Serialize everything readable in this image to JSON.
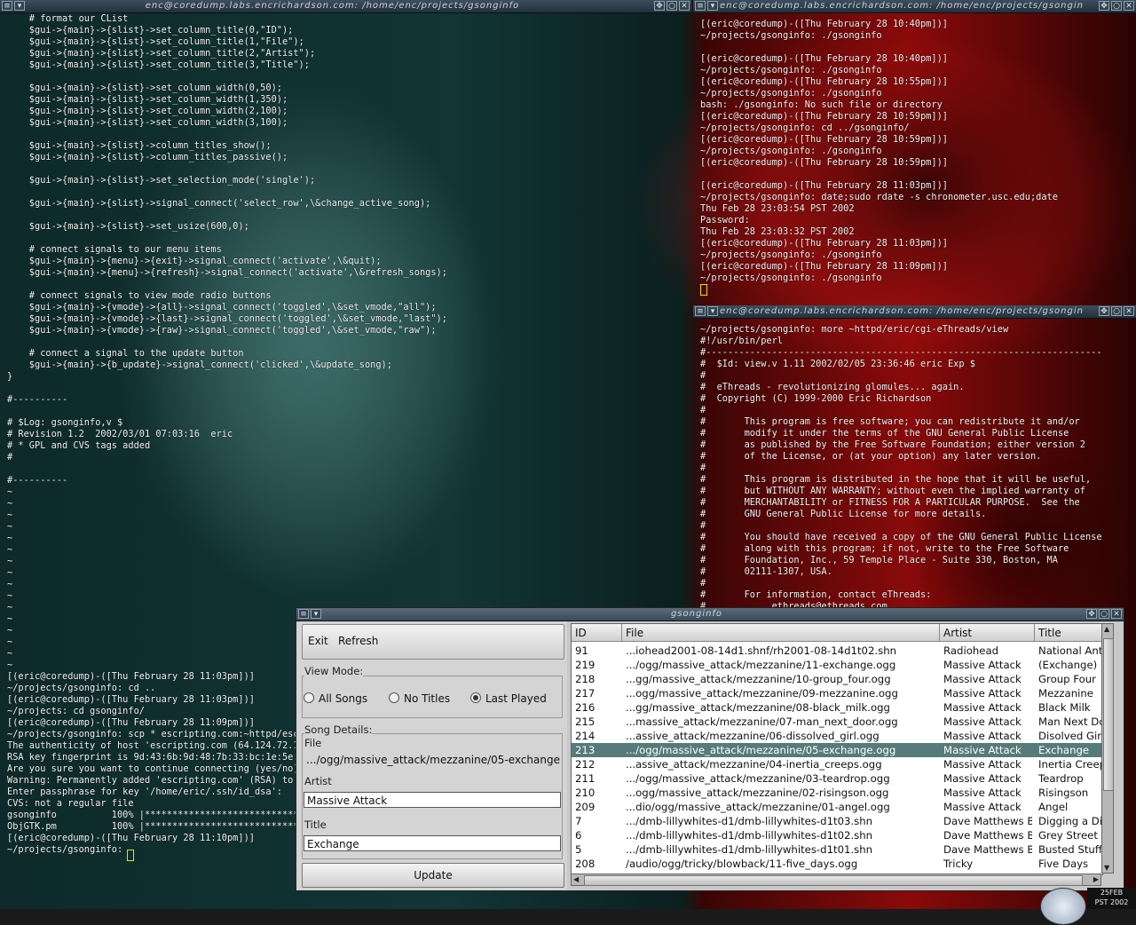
{
  "colors": {
    "cursor": "#e6e600",
    "selection": "#577a7a"
  },
  "left_terminal": {
    "title": "enc@coredump.labs.encrichardson.com: /home/enc/projects/gsonginfo",
    "content": "    # format our CList\n    $gui->{main}->{slist}->set_column_title(0,\"ID\");\n    $gui->{main}->{slist}->set_column_title(1,\"File\");\n    $gui->{main}->{slist}->set_column_title(2,\"Artist\");\n    $gui->{main}->{slist}->set_column_title(3,\"Title\");\n\n    $gui->{main}->{slist}->set_column_width(0,50);\n    $gui->{main}->{slist}->set_column_width(1,350);\n    $gui->{main}->{slist}->set_column_width(2,100);\n    $gui->{main}->{slist}->set_column_width(3,100);\n\n    $gui->{main}->{slist}->column_titles_show();\n    $gui->{main}->{slist}->column_titles_passive();\n\n    $gui->{main}->{slist}->set_selection_mode('single');\n\n    $gui->{main}->{slist}->signal_connect('select_row',\\&change_active_song);\n\n    $gui->{main}->{slist}->set_usize(600,0);\n\n    # connect signals to our menu items\n    $gui->{main}->{menu}->{exit}->signal_connect('activate',\\&quit);\n    $gui->{main}->{menu}->{refresh}->signal_connect('activate',\\&refresh_songs);\n\n    # connect signals to view mode radio buttons\n    $gui->{main}->{vmode}->{all}->signal_connect('toggled',\\&set_vmode,\"all\");\n    $gui->{main}->{vmode}->{last}->signal_connect('toggled',\\&set_vmode,\"last\");\n    $gui->{main}->{vmode}->{raw}->signal_connect('toggled',\\&set_vmode,\"raw\");\n\n    # connect a signal to the update button\n    $gui->{main}->{b_update}->signal_connect('clicked',\\&update_song);\n}\n\n#----------\n\n# $Log: gsonginfo,v $\n# Revision 1.2  2002/03/01 07:03:16  eric\n# * GPL and CVS tags added\n#\n\n#----------\n~\n~\n~\n~\n~\n~\n~\n~\n~\n~\n~\n~\n~\n~\n~\n~\n[(eric@coredump)-([Thu February 28 11:03pm])]\n~/projects/gsonginfo: cd ..\n[(eric@coredump)-([Thu February 28 11:03pm])]\n~/projects: cd gsonginfo/\n[(eric@coredump)-([Thu February 28 11:09pm])]\n~/projects/gsonginfo: scp * escripting.com:~httpd/escripting\nThe authenticity of host 'escripting.com (64.124.72.10)' can't be established.\nRSA key fingerprint is 9d:43:6b:9d:48:7b:33:bc:1e:5e:c7\nAre you sure you want to continue connecting (yes/no)? yes\nWarning: Permanently added 'escripting.com' (RSA) to the list of known hosts.\nEnter passphrase for key '/home/eric/.ssh/id_dsa':\nCVS: not a regular file\ngsonginfo          100% |*********************************\nObjGTK.pm          100% |*********************************\n[(eric@coredump)-([Thu February 28 11:10pm])]\n~/projects/gsonginfo: "
  },
  "right_top_terminal": {
    "title": "enc@coredump.labs.encrichardson.com: /home/enc/projects/gsonginfo",
    "content": "[(eric@coredump)-([Thu February 28 10:40pm])]\n~/projects/gsonginfo: ./gsonginfo\n\n[(eric@coredump)-([Thu February 28 10:40pm])]\n~/projects/gsonginfo: ./gsonginfo\n[(eric@coredump)-([Thu February 28 10:55pm])]\n~/projects/gsonginfo: ./gsonginfo\nbash: ./gsonginfo: No such file or directory\n[(eric@coredump)-([Thu February 28 10:59pm])]\n~/projects/gsonginfo: cd ../gsonginfo/\n[(eric@coredump)-([Thu February 28 10:59pm])]\n~/projects/gsonginfo: ./gsonginfo\n[(eric@coredump)-([Thu February 28 10:59pm])]\n\n[(eric@coredump)-([Thu February 28 11:03pm])]\n~/projects/gsonginfo: date;sudo rdate -s chronometer.usc.edu;date\nThu Feb 28 23:03:54 PST 2002\nPassword:\nThu Feb 28 23:03:32 PST 2002\n[(eric@coredump)-([Thu February 28 11:03pm])]\n~/projects/gsonginfo: ./gsonginfo\n[(eric@coredump)-([Thu February 28 11:09pm])]\n~/projects/gsonginfo: ./gsonginfo\n"
  },
  "right_bottom_terminal": {
    "title": "enc@coredump.labs.encrichardson.com: /home/enc/projects/gsonginfo",
    "content": "~/projects/gsonginfo: more ~httpd/eric/cgi-eThreads/view\n#!/usr/bin/perl\n#------------------------------------------------------------------------\n#  $Id: view.v 1.11 2002/02/05 23:36:46 eric Exp $\n#\n#  eThreads - revolutionizing glomules... again.\n#  Copyright (C) 1999-2000 Eric Richardson\n#\n#       This program is free software; you can redistribute it and/or\n#       modify it under the terms of the GNU General Public License\n#       as published by the Free Software Foundation; either version 2\n#       of the License, or (at your option) any later version.\n#\n#       This program is distributed in the hope that it will be useful,\n#       but WITHOUT ANY WARRANTY; without even the implied warranty of\n#       MERCHANTABILITY or FITNESS FOR A PARTICULAR PURPOSE.  See the\n#       GNU General Public License for more details.\n#\n#       You should have received a copy of the GNU General Public License\n#       along with this program; if not, write to the Free Software\n#       Foundation, Inc., 59 Temple Place - Suite 330, Boston, MA\n#       02111-1307, USA.\n#\n#       For information, contact eThreads:\n#            ethreads@ethreads.com"
  },
  "gsonginfo": {
    "title": "gsonginfo",
    "menu": {
      "exit": "Exit",
      "refresh": "Refresh"
    },
    "view_mode": {
      "label": "View Mode:",
      "options": [
        "All Songs",
        "No Titles",
        "Last Played"
      ],
      "selected": "Last Played"
    },
    "song_details": {
      "label": "Song Details:",
      "file_label": "File",
      "file_value": ".../ogg/massive_attack/mezzanine/05-exchange.ogg",
      "artist_label": "Artist",
      "artist_value": "Massive Attack",
      "title_label": "Title",
      "title_value": "Exchange"
    },
    "update_label": "Update",
    "columns": [
      "ID",
      "File",
      "Artist",
      "Title"
    ],
    "selected_index": 7,
    "rows": [
      {
        "id": "91",
        "file": "...iohead2001-08-14d1.shnf/rh2001-08-14d1t02.shn",
        "artist": "Radiohead",
        "title": "National Antl"
      },
      {
        "id": "219",
        "file": ".../ogg/massive_attack/mezzanine/11-exchange.ogg",
        "artist": "Massive Attack",
        "title": "(Exchange)"
      },
      {
        "id": "218",
        "file": "...gg/massive_attack/mezzanine/10-group_four.ogg",
        "artist": "Massive Attack",
        "title": "Group Four"
      },
      {
        "id": "217",
        "file": "...ogg/massive_attack/mezzanine/09-mezzanine.ogg",
        "artist": "Massive Attack",
        "title": "Mezzanine"
      },
      {
        "id": "216",
        "file": "...gg/massive_attack/mezzanine/08-black_milk.ogg",
        "artist": "Massive Attack",
        "title": "Black Milk"
      },
      {
        "id": "215",
        "file": "...massive_attack/mezzanine/07-man_next_door.ogg",
        "artist": "Massive Attack",
        "title": "Man Next Dc"
      },
      {
        "id": "214",
        "file": "...assive_attack/mezzanine/06-dissolved_girl.ogg",
        "artist": "Massive Attack",
        "title": "Disolved Girl"
      },
      {
        "id": "213",
        "file": ".../ogg/massive_attack/mezzanine/05-exchange.ogg",
        "artist": "Massive Attack",
        "title": "Exchange"
      },
      {
        "id": "212",
        "file": "...assive_attack/mezzanine/04-inertia_creeps.ogg",
        "artist": "Massive Attack",
        "title": "Inertia Creep"
      },
      {
        "id": "211",
        "file": ".../ogg/massive_attack/mezzanine/03-teardrop.ogg",
        "artist": "Massive Attack",
        "title": "Teardrop"
      },
      {
        "id": "210",
        "file": "...ogg/massive_attack/mezzanine/02-risingson.ogg",
        "artist": "Massive Attack",
        "title": "Risingson"
      },
      {
        "id": "209",
        "file": "...dio/ogg/massive_attack/mezzanine/01-angel.ogg",
        "artist": "Massive Attack",
        "title": "Angel"
      },
      {
        "id": "7",
        "file": ".../dmb-lillywhites-d1/dmb-lillywhites-d1t03.shn",
        "artist": "Dave Matthews B",
        "title": "Digging a Di"
      },
      {
        "id": "6",
        "file": ".../dmb-lillywhites-d1/dmb-lillywhites-d1t02.shn",
        "artist": "Dave Matthews B",
        "title": "Grey Street"
      },
      {
        "id": "5",
        "file": ".../dmb-lillywhites-d1/dmb-lillywhites-d1t01.shn",
        "artist": "Dave Matthews B",
        "title": "Busted Stuff"
      },
      {
        "id": "208",
        "file": "/audio/ogg/tricky/blowback/11-five_days.ogg",
        "artist": "Tricky",
        "title": "Five Days"
      }
    ]
  },
  "tray": {
    "date_line1": "25FEB",
    "date_line2": "PST 2002"
  }
}
